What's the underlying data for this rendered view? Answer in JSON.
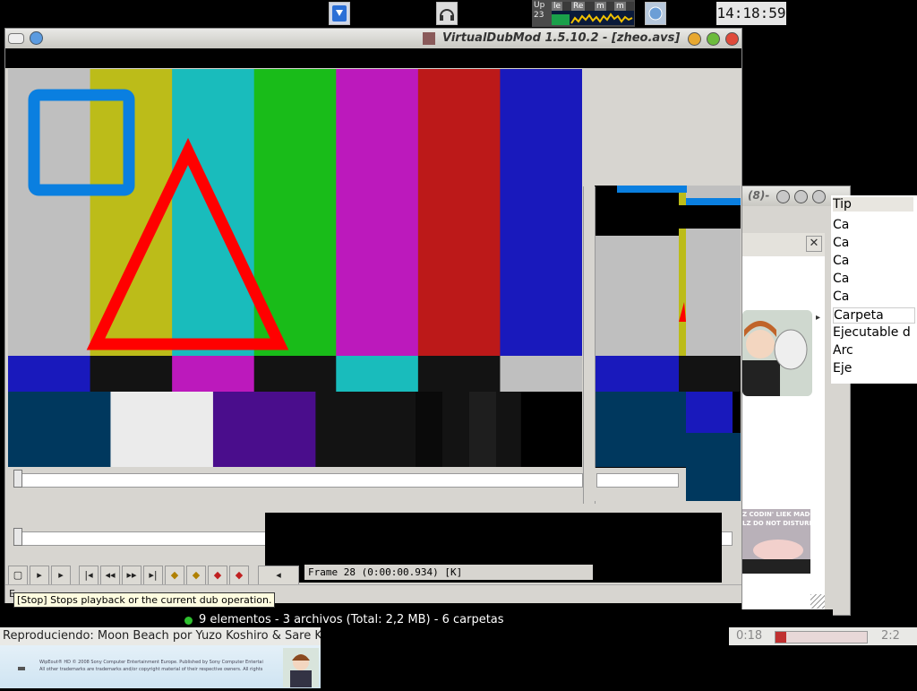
{
  "taskbar": {
    "clock": "14:18:59",
    "monitor_label_top": "Up",
    "monitor_label_bottom": "23",
    "monitor_tabs": [
      "le",
      "Re",
      "m",
      "m"
    ]
  },
  "vdub": {
    "title": "VirtualDubMod 1.5.10.2 - [zheo.avs]",
    "frame_info": "Frame 28 (0:00:00.934) [K]",
    "tooltip": "[Stop] Stops playback or the current dub operation.",
    "status_fragment": "E"
  },
  "filewin": {
    "title_fragment": "(8)-",
    "column_header": "Tip",
    "rows": [
      "Ca",
      "Ca",
      "Ca",
      "Ca",
      "Ca",
      "Carpeta",
      "Ejecutable d",
      "Arc",
      "Eje"
    ],
    "status": "9 elementos - 3 archivos (Total: 2,2 MB) - 6 carpetas",
    "meme_lines": [
      "Z CODIN' LIEK MADCAT",
      "LZ DO NOT DISTURB"
    ],
    "close_glyph": "✕"
  },
  "player": {
    "now_playing": "Reproduciendo: Moon Beach por Yuzo Koshiro & Sare Kr",
    "time": "0:18",
    "duration": "2:2"
  },
  "desktop": {
    "legal_1": "WipEout® HD © 2008 Sony Computer Entertainment Europe. Published by Sony Computer Entertainment",
    "legal_2": "All other trademarks are trademarks and/or copyright material of their respective owners. All rights reserve"
  },
  "colors": {
    "smpte_top": [
      "#bfbfbf",
      "#bcbc19",
      "#19bcbc",
      "#19bc19",
      "#bc19bc",
      "#bc1919",
      "#1919bc"
    ],
    "smpte_mid": [
      "#1919bc",
      "#131313",
      "#bc19bc",
      "#131313",
      "#19bcbc",
      "#131313",
      "#bfbfbf"
    ],
    "smpte_bottom": [
      "#00385e",
      "#ebebeb",
      "#4a0d8c",
      "#131313",
      "#131313"
    ],
    "shape_square": "#0a7fe0",
    "shape_triangle": "#ff0000"
  }
}
